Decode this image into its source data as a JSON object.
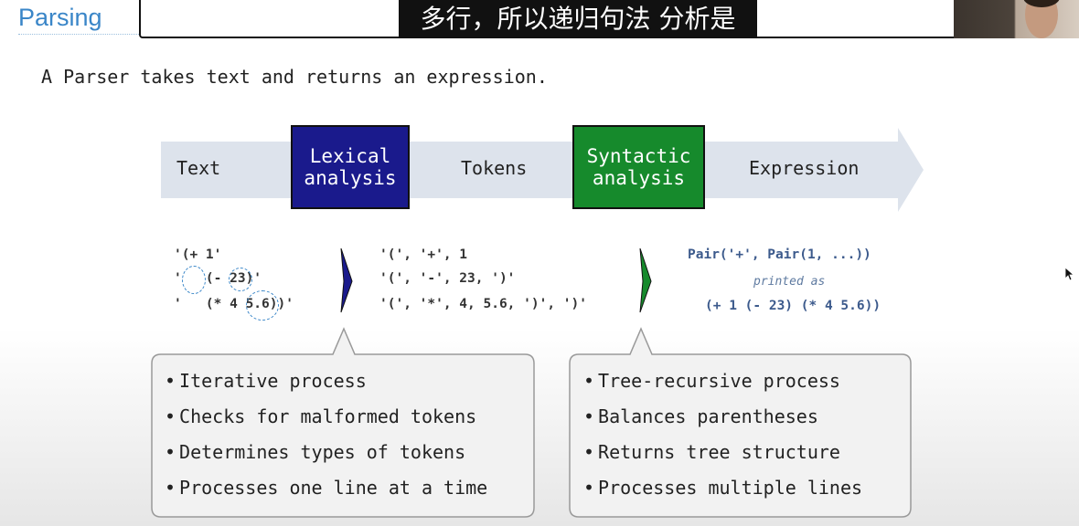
{
  "slide": {
    "title": "Parsing",
    "intro": "A Parser takes text and returns an expression."
  },
  "caption": "多行，所以递归句法 分析是",
  "pipeline": {
    "text_label": "Text",
    "lexical_box": [
      "Lexical",
      "analysis"
    ],
    "tokens_label": "Tokens",
    "syntactic_box": [
      "Syntactic",
      "analysis"
    ],
    "expression_label": "Expression",
    "colors": {
      "lexical": "#1a1a8c",
      "syntactic": "#168a2c",
      "arrow": "#dde3ec"
    }
  },
  "examples": {
    "text_lines": [
      "'(+ 1'",
      "'   (- 23)'",
      "'   (* 4 5.6))'"
    ],
    "token_lines": [
      "'(', '+', 1",
      "'(', '-', 23, ')'",
      "'(', '*', 4, 5.6, ')', ')'"
    ],
    "expression_line": "Pair('+', Pair(1, ...))",
    "printed_as": "printed as",
    "printed_expression": "(+ 1 (- 23) (* 4 5.6))"
  },
  "lexical_points": [
    "Iterative process",
    "Checks for malformed tokens",
    "Determines types of tokens",
    "Processes one line at a time"
  ],
  "syntactic_points": [
    "Tree-recursive process",
    "Balances parentheses",
    "Returns tree structure",
    "Processes multiple lines"
  ]
}
